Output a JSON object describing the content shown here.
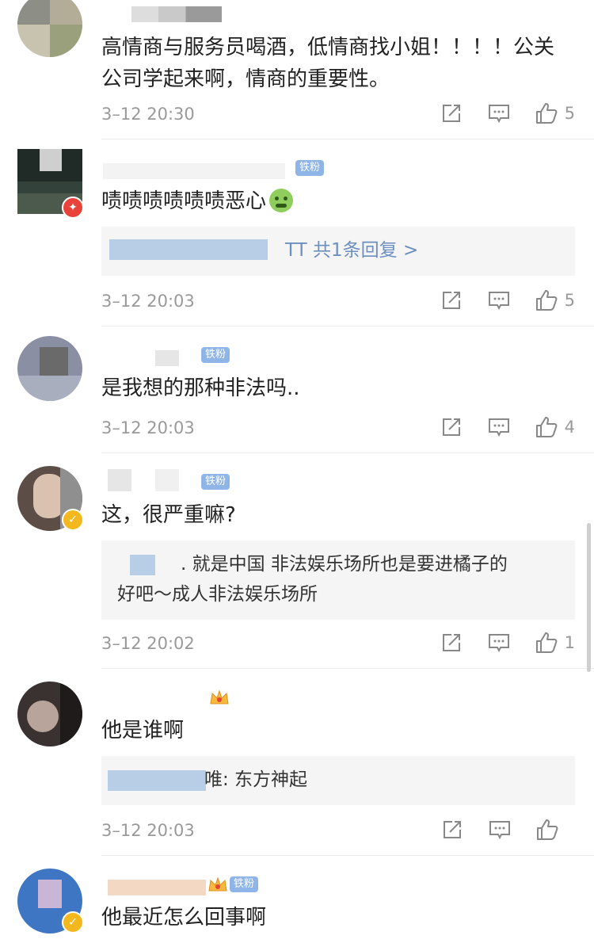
{
  "comments": [
    {
      "text": "高情商与服务员喝酒，低情商找小姐！！！！公关公司学起来啊，情商的重要性。",
      "time": "3–12 20:30",
      "likes": "5"
    },
    {
      "text": "啧啧啧啧啧啧恶心",
      "fan_tag": "铁粉",
      "reply": {
        "text": "TT  共1条回复 >"
      },
      "time": "3–12 20:03",
      "likes": "5"
    },
    {
      "text": "是我想的那种非法吗..",
      "fan_tag": "铁粉",
      "time": "3–12 20:03",
      "likes": "4"
    },
    {
      "text": "这，很严重嘛?",
      "fan_tag": "铁粉",
      "reply": {
        "text_line1": ". 就是中国 非法娱乐场所也是要进橘子的",
        "text_line2": "好吧～成人非法娱乐场所"
      },
      "time": "3–12 20:02",
      "likes": "1"
    },
    {
      "text": "他是谁啊",
      "reply": {
        "text": "唯: 东方神起"
      },
      "time": "3–12 20:03",
      "likes": ""
    },
    {
      "text": "他最近怎么回事啊",
      "fan_tag": "铁粉"
    }
  ],
  "icons": {
    "share": "share-icon",
    "comment": "comment-icon",
    "like": "thumbs-up-icon",
    "sick_emoji": "nauseated-face-emoji",
    "crown": "crown-icon"
  },
  "colors": {
    "fan_tag": "#8fb5e8",
    "link": "#6c8fc0",
    "meta": "#999999"
  }
}
